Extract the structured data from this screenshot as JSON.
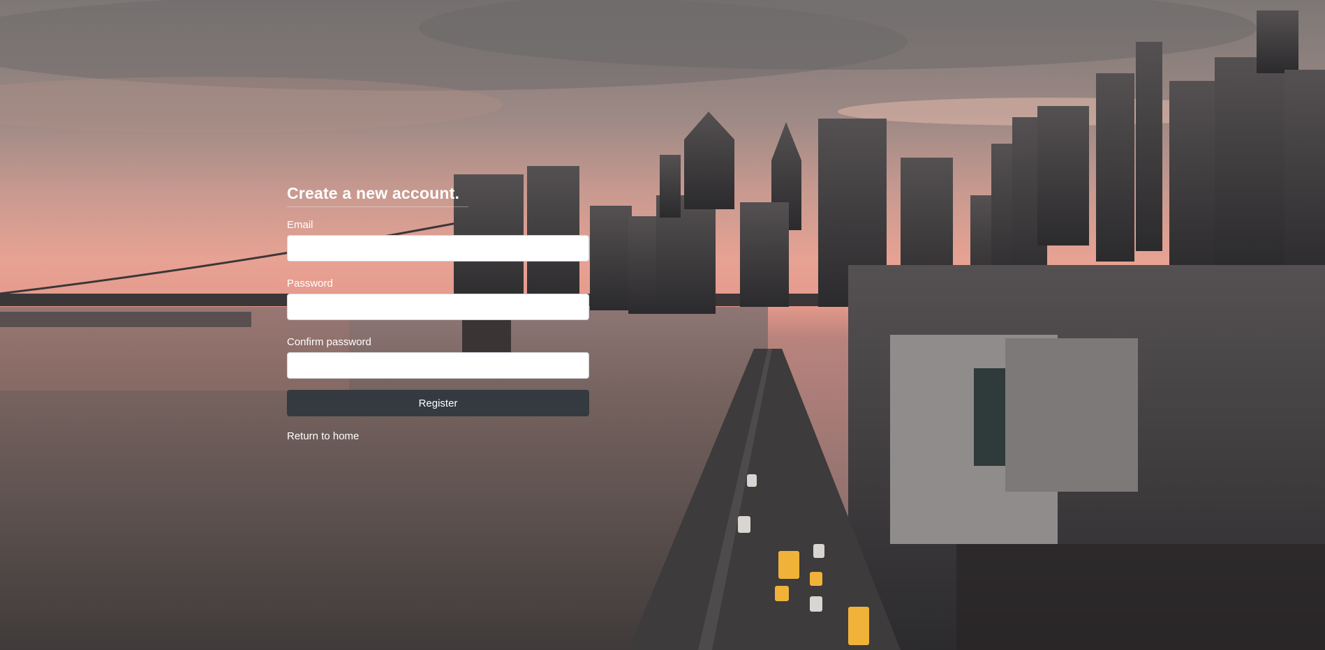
{
  "background": {
    "description_icon": "city-skyline-background"
  },
  "form": {
    "title": "Create a new account.",
    "email_label": "Email",
    "email_value": "",
    "password_label": "Password",
    "password_value": "",
    "confirm_label": "Confirm password",
    "confirm_value": "",
    "register_label": "Register",
    "home_link": "Return to home"
  },
  "colors": {
    "button_bg": "#343a40",
    "text": "#ffffff",
    "sky_pink": "#e8a69a",
    "water": "#5b5857"
  }
}
